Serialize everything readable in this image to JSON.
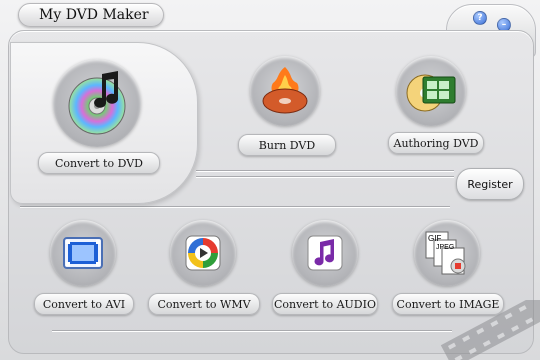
{
  "window": {
    "title": "My DVD Maker"
  },
  "controls": {
    "help": "?",
    "minimize": "–",
    "close": "×"
  },
  "main": {
    "tools": [
      {
        "label": "Convert to DVD",
        "icon": "cd-music-icon",
        "selected": true
      },
      {
        "label": "Burn DVD",
        "icon": "burn-disc-icon"
      },
      {
        "label": "Authoring DVD",
        "icon": "film-disc-icon"
      }
    ],
    "register_label": "Register",
    "converters": [
      {
        "label": "Convert to AVI",
        "icon": "film-file-icon"
      },
      {
        "label": "Convert to WMV",
        "icon": "windows-media-icon"
      },
      {
        "label": "Convert to AUDIO",
        "icon": "music-note-icon"
      },
      {
        "label": "Convert to IMAGE",
        "icon": "image-files-icon"
      }
    ]
  },
  "image_icon_labels": {
    "gif": "GIF",
    "jpeg": "JPEG"
  },
  "colors": {
    "accent_blue": "#3a6fd6",
    "close_red": "#d43a2e",
    "purple_icon": "#7a2aa8"
  }
}
